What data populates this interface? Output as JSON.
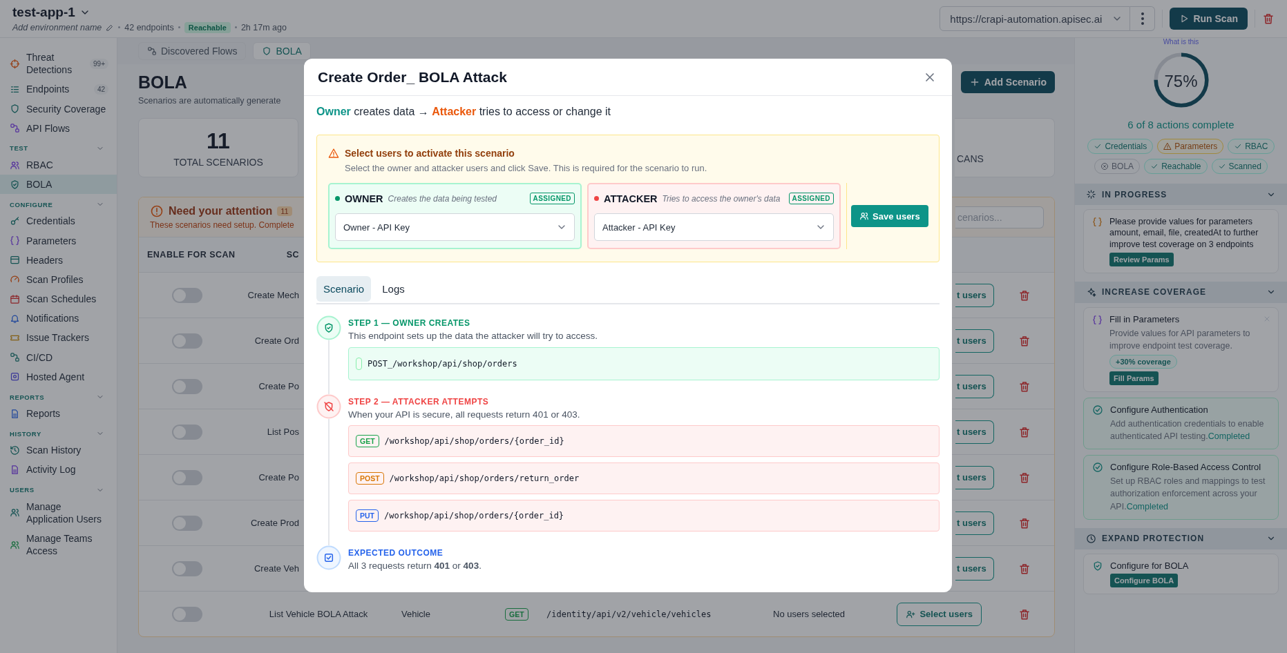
{
  "header": {
    "app_name": "test-app-1",
    "env_placeholder": "Add environment name",
    "endpoints": "42 endpoints",
    "status": "Reachable",
    "last_seen": "2h 17m ago",
    "url": "https://crapi-automation.apisec.ai",
    "run_button": "Run Scan"
  },
  "sidebar": {
    "sections": [
      {
        "items": [
          {
            "label": "Threat Detections",
            "badge": "99+",
            "selected": false
          },
          {
            "label": "Endpoints",
            "badge": "42",
            "selected": false
          },
          {
            "label": "Security Coverage",
            "selected": false
          },
          {
            "label": "API Flows",
            "selected": false
          }
        ]
      },
      {
        "title": "TEST",
        "expanded": true,
        "items": [
          {
            "label": "RBAC",
            "selected": false
          },
          {
            "label": "BOLA",
            "selected": true
          }
        ]
      },
      {
        "title": "CONFIGURE",
        "expanded": true,
        "items": [
          {
            "label": "Credentials",
            "selected": false
          },
          {
            "label": "Parameters",
            "selected": false
          },
          {
            "label": "Headers",
            "selected": false
          },
          {
            "label": "Scan Profiles",
            "selected": false
          },
          {
            "label": "Scan Schedules",
            "selected": false
          },
          {
            "label": "Notifications",
            "selected": false
          },
          {
            "label": "Issue Trackers",
            "selected": false
          },
          {
            "label": "CI/CD",
            "selected": false
          },
          {
            "label": "Hosted Agent",
            "selected": false
          }
        ]
      },
      {
        "title": "REPORTS",
        "expanded": true,
        "items": [
          {
            "label": "Reports",
            "selected": false
          }
        ]
      },
      {
        "title": "HISTORY",
        "expanded": true,
        "items": [
          {
            "label": "Scan History",
            "selected": false
          },
          {
            "label": "Activity Log",
            "selected": false
          }
        ]
      },
      {
        "title": "USERS",
        "expanded": true,
        "items": [
          {
            "label": "Manage Application Users",
            "selected": false
          },
          {
            "label": "Manage Teams Access",
            "selected": false
          }
        ]
      }
    ]
  },
  "main": {
    "tabs": [
      {
        "label": "Discovered Flows",
        "selected": false
      },
      {
        "label": "BOLA",
        "selected": true
      }
    ],
    "title": "BOLA",
    "subtitle": "Scenarios are automatically generate",
    "add_button": "Add Scenario",
    "stats": [
      {
        "value": "11",
        "label": "TOTAL SCENARIOS"
      },
      {
        "label": "CANS"
      }
    ],
    "attention": {
      "title": "Need your attention",
      "count": "11",
      "text": "These scenarios need setup. Complete",
      "search_placeholder": "cenarios...",
      "columns": [
        "ENABLE FOR SCAN",
        "SC"
      ],
      "rows": [
        {
          "kind": "covered",
          "enabled": false,
          "scenario": "Create Mech",
          "action": "t users"
        },
        {
          "kind": "covered",
          "enabled": false,
          "scenario": "Create Ord",
          "action": "t users"
        },
        {
          "kind": "covered",
          "enabled": false,
          "scenario": "Create Po",
          "action": "t users"
        },
        {
          "kind": "covered",
          "enabled": false,
          "scenario": "List Pos",
          "action": "t users"
        },
        {
          "kind": "covered",
          "enabled": false,
          "scenario": "Create Po",
          "action": "t users"
        },
        {
          "kind": "covered",
          "enabled": false,
          "scenario": "Create Prod",
          "action": "t users"
        },
        {
          "kind": "covered",
          "enabled": false,
          "scenario": "Create Veh",
          "action": "t users"
        },
        {
          "kind": "full",
          "enabled": false,
          "scenario": "List Vehicle BOLA Attack",
          "resource": "Vehicle",
          "method": "GET",
          "endpoint": "/identity/api/v2/vehicle/vehicles",
          "users": "No users selected",
          "action": "Select users"
        }
      ]
    }
  },
  "modal": {
    "title": "Create Order_ BOLA Attack",
    "flow": {
      "owner": "Owner",
      "middle": "creates data →",
      "attacker": "Attacker",
      "rest": "tries to access or change it"
    },
    "alert": {
      "title": "Select users to activate this scenario",
      "text": "Select the owner and attacker users and click Save. This is required for the scenario to run."
    },
    "roles": [
      {
        "kind": "owner",
        "name": "OWNER",
        "hint": "Creates the data being tested",
        "badge": "ASSIGNED",
        "value": "Owner - API Key",
        "color": "#059669"
      },
      {
        "kind": "attacker",
        "name": "ATTACKER",
        "hint": "Tries to access the owner's data",
        "badge": "ASSIGNED",
        "value": "Attacker - API Key",
        "color": "#ef4444"
      }
    ],
    "save_button": "Save users",
    "tabs": [
      {
        "label": "Scenario",
        "selected": true
      },
      {
        "label": "Logs",
        "selected": false
      }
    ],
    "steps": [
      {
        "kind": "owner",
        "title": "STEP 1 — OWNER CREATES",
        "text": "This endpoint sets up the data the attacker will try to access.",
        "requests": [
          {
            "path": "POST_/workshop/api/shop/orders"
          }
        ]
      },
      {
        "kind": "attacker",
        "title": "STEP 2 — ATTACKER ATTEMPTS",
        "text": "When your API is secure, all requests return 401 or 403.",
        "requests": [
          {
            "method": "GET",
            "color": "#16a34a",
            "path": "/workshop/api/shop/orders/{order_id}"
          },
          {
            "method": "POST",
            "color": "#d97706",
            "path": "/workshop/api/shop/orders/return_order"
          },
          {
            "method": "PUT",
            "color": "#2563eb",
            "path": "/workshop/api/shop/orders/{order_id}"
          }
        ]
      },
      {
        "kind": "outcome",
        "title": "EXPECTED OUTCOME",
        "text": "All 3 requests return **401** or **403**."
      }
    ]
  },
  "panel": {
    "help_link": "What is this",
    "progress": {
      "level": 0.75,
      "label": "75%",
      "caption": "6 of 8 actions complete"
    },
    "chips": [
      {
        "label": "Credentials",
        "kind": "done"
      },
      {
        "label": "Parameters",
        "kind": "warning"
      },
      {
        "label": "RBAC",
        "kind": "done"
      },
      {
        "label": "BOLA",
        "kind": "failed"
      },
      {
        "label": "Reachable",
        "kind": "done"
      },
      {
        "label": "Scanned",
        "kind": "done"
      }
    ],
    "sections": [
      {
        "title": "IN PROGRESS",
        "kind": "progress",
        "expanded": true,
        "cards": [
          {
            "kind": "task",
            "text": "Please provide values for parameters amount, email, file, createdAt to further improve test coverage on 3 endpoints",
            "button": "Review Params"
          }
        ]
      },
      {
        "title": "INCREASE COVERAGE",
        "kind": "coverage",
        "expanded": true,
        "cards": [
          {
            "kind": "suggestion",
            "title": "Fill in Parameters",
            "text": "Provide values for API parameters to improve endpoint test coverage.",
            "gain": "+30% coverage",
            "button": "Fill Params"
          },
          {
            "kind": "completed",
            "title": "Configure Authentication",
            "text": "Add authentication credentials to enable authenticated API testing.",
            "status": "Completed"
          },
          {
            "kind": "completed",
            "title": "Configure Role-Based Access Control",
            "text": "Set up RBAC roles and mappings to test authorization enforcement across your API.",
            "status": "Completed"
          }
        ]
      },
      {
        "title": "EXPAND PROTECTION",
        "kind": "protection",
        "expanded": true,
        "cards": [
          {
            "kind": "protect",
            "title": "Configure for BOLA",
            "button": "Configure BOLA"
          }
        ]
      }
    ]
  }
}
